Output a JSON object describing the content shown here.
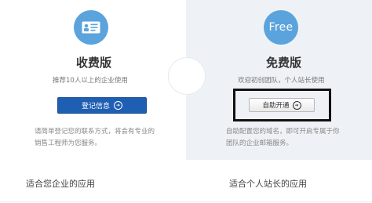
{
  "left": {
    "icon": "id-card-icon",
    "title": "收费版",
    "subtitle": "推荐10人以上的企业使用",
    "button_label": "登记信息",
    "desc_line1": "请简单登记您的联系方式，将会有专业的",
    "desc_line2": "销售工程师为您服务。",
    "bottom_label": "适合您企业的应用"
  },
  "right": {
    "icon_text": "Free",
    "title": "免费版",
    "subtitle": "欢迎初创团队，个人站长使用",
    "button_label": "自助开通",
    "desc_line1": "自助配置您的域名，即可开启专属于你",
    "desc_line2": "团队的企业邮箱服务。",
    "bottom_label": "适合个人站长的应用"
  },
  "colors": {
    "accent": "#5ba3dc",
    "primary_button": "#1f5fb3",
    "right_panel_bg": "#eef2f6"
  }
}
